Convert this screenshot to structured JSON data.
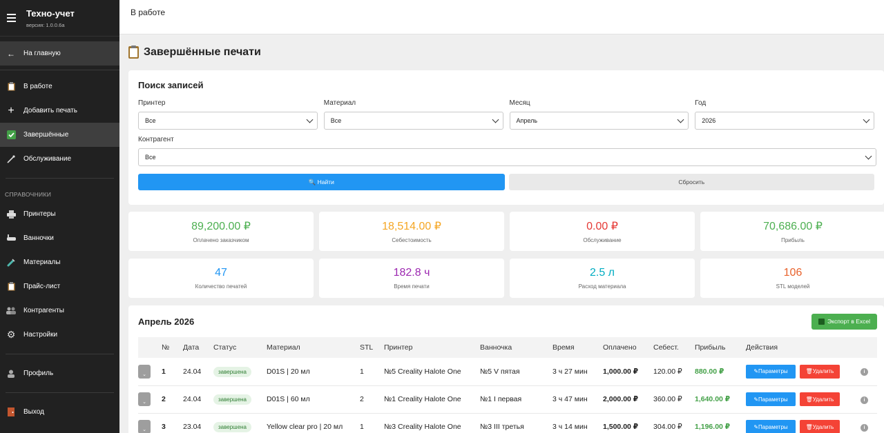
{
  "app": {
    "title": "Техно-учет",
    "version": "версия: 1.0.0.6a"
  },
  "sidebar": {
    "back": "На главную",
    "items": [
      {
        "label": "В работе",
        "icon": "clipboard-icon"
      },
      {
        "label": "Добавить печать",
        "icon": "plus-icon"
      },
      {
        "label": "Завершённые",
        "icon": "check-box-icon"
      },
      {
        "label": "Обслуживание",
        "icon": "wrench-icon"
      }
    ],
    "section_label": "СПРАВОЧНИКИ",
    "ref_items": [
      {
        "label": "Принтеры",
        "icon": "printer-icon"
      },
      {
        "label": "Ванночки",
        "icon": "bath-icon"
      },
      {
        "label": "Материалы",
        "icon": "test-tube-icon"
      },
      {
        "label": "Прайс-лист",
        "icon": "clipboard-icon"
      },
      {
        "label": "Контрагенты",
        "icon": "people-icon"
      },
      {
        "label": "Настройки",
        "icon": "gear-icon"
      }
    ],
    "profile": "Профиль",
    "logout": "Выход"
  },
  "topbar": {
    "title": "В работе"
  },
  "page": {
    "title": "Завершённые печати"
  },
  "search": {
    "title": "Поиск записей",
    "printer": {
      "label": "Принтер",
      "value": "Все"
    },
    "material": {
      "label": "Материал",
      "value": "Все"
    },
    "month": {
      "label": "Месяц",
      "value": "Апрель"
    },
    "year": {
      "label": "Год",
      "value": "2026"
    },
    "contractor": {
      "label": "Контрагент",
      "value": "Все"
    },
    "find_label": "🔍 Найти",
    "reset_label": "Сбросить"
  },
  "stats": [
    {
      "value": "89,200.00 ₽",
      "label": "Оплачено заказчиком",
      "color": "#4caf50"
    },
    {
      "value": "18,514.00 ₽",
      "label": "Себестоимость",
      "color": "#f5a623"
    },
    {
      "value": "0.00 ₽",
      "label": "Обслуживание",
      "color": "#e53935"
    },
    {
      "value": "70,686.00 ₽",
      "label": "Прибыль",
      "color": "#4caf50"
    },
    {
      "value": "47",
      "label": "Количество печатей",
      "color": "#2196f3"
    },
    {
      "value": "182.8 ч",
      "label": "Время печати",
      "color": "#9c27b0"
    },
    {
      "value": "2.5 л",
      "label": "Расход материала",
      "color": "#00acc1"
    },
    {
      "value": "106",
      "label": "STL моделей",
      "color": "#e8622c"
    }
  ],
  "table": {
    "title": "Апрель 2026",
    "export_label": "Экспорт в Excel",
    "columns": [
      "№",
      "Дата",
      "Статус",
      "Материал",
      "STL",
      "Принтер",
      "Ванночка",
      "Время",
      "Оплачено",
      "Себест.",
      "Прибыль",
      "Действия"
    ],
    "params_label": "Параметры",
    "delete_label": "Удалить",
    "rows": [
      {
        "num": "1",
        "date": "24.04",
        "status": "завершена",
        "material": "D01S | 20 мл",
        "stl": "1",
        "printer": "№5 Creality Halote One",
        "bath": "№5 V пятая",
        "time": "3 ч 27 мин",
        "paid": "1,000.00 ₽",
        "cost": "120.00 ₽",
        "profit": "880.00 ₽"
      },
      {
        "num": "2",
        "date": "24.04",
        "status": "завершена",
        "material": "D01S | 60 мл",
        "stl": "2",
        "printer": "№1 Creality Halote One",
        "bath": "№1 I первая",
        "time": "3 ч 47 мин",
        "paid": "2,000.00 ₽",
        "cost": "360.00 ₽",
        "profit": "1,640.00 ₽"
      },
      {
        "num": "3",
        "date": "23.04",
        "status": "завершена",
        "material": "Yellow clear pro | 20 мл",
        "stl": "1",
        "printer": "№3 Creality Halote One",
        "bath": "№3 III третья",
        "time": "3 ч 14 мин",
        "paid": "1,500.00 ₽",
        "cost": "304.00 ₽",
        "profit": "1,196.00 ₽"
      }
    ]
  }
}
